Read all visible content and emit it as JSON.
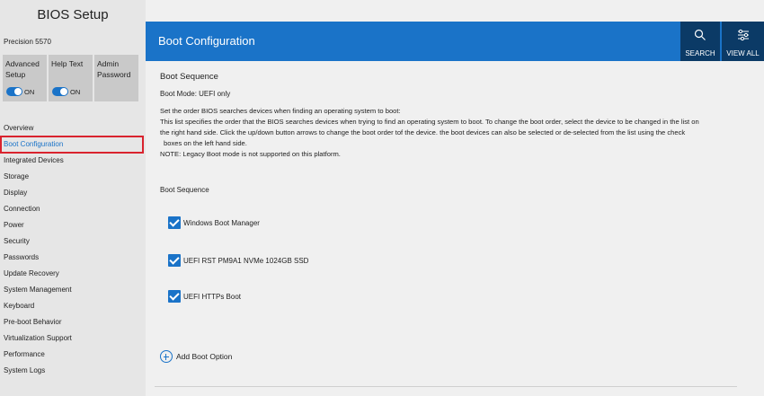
{
  "sidebar": {
    "app_title": "BIOS Setup",
    "model": "Precision 5570",
    "tiles": [
      {
        "label": "Advanced Setup",
        "toggle": "ON",
        "has_toggle": true
      },
      {
        "label": "Help Text",
        "toggle": "ON",
        "has_toggle": true
      },
      {
        "label": "Admin Password",
        "has_toggle": false
      }
    ],
    "nav": [
      "Overview",
      "Boot Configuration",
      "Integrated Devices",
      "Storage",
      "Display",
      "Connection",
      "Power",
      "Security",
      "Passwords",
      "Update Recovery",
      "System Management",
      "Keyboard",
      "Pre-boot Behavior",
      "Virtualization Support",
      "Performance",
      "System Logs"
    ],
    "active_nav": "Boot Configuration"
  },
  "header": {
    "title": "Boot Configuration",
    "search_label": "SEARCH",
    "view_all_label": "VIEW ALL",
    "color": "#1a73c8",
    "button_color": "#0b3a66"
  },
  "content": {
    "section_title": "Boot Sequence",
    "boot_mode": "Boot Mode: UEFI only",
    "description": {
      "line1": "Set the order BIOS searches devices when finding an operating system to boot:",
      "line2": "This list specifies the order that the BIOS searches devices when trying to find an operating system to boot. To change the boot order, select the device to be changed in the list on",
      "line3": "the right hand side. Click the up/down button arrows to change the boot order tof the device. the boot devices can also be selected or de-selected from the list using the check",
      "line4": "boxes on the left hand side.",
      "line5": "NOTE: Legacy Boot mode is not supported on this platform."
    },
    "sequence_label": "Boot Sequence",
    "boot_items": [
      {
        "label": "Windows Boot Manager",
        "checked": true
      },
      {
        "label": "UEFI RST PM9A1 NVMe 1024GB SSD",
        "checked": true
      },
      {
        "label": "UEFI HTTPs Boot",
        "checked": true
      }
    ],
    "add_boot_label": "Add Boot Option"
  }
}
